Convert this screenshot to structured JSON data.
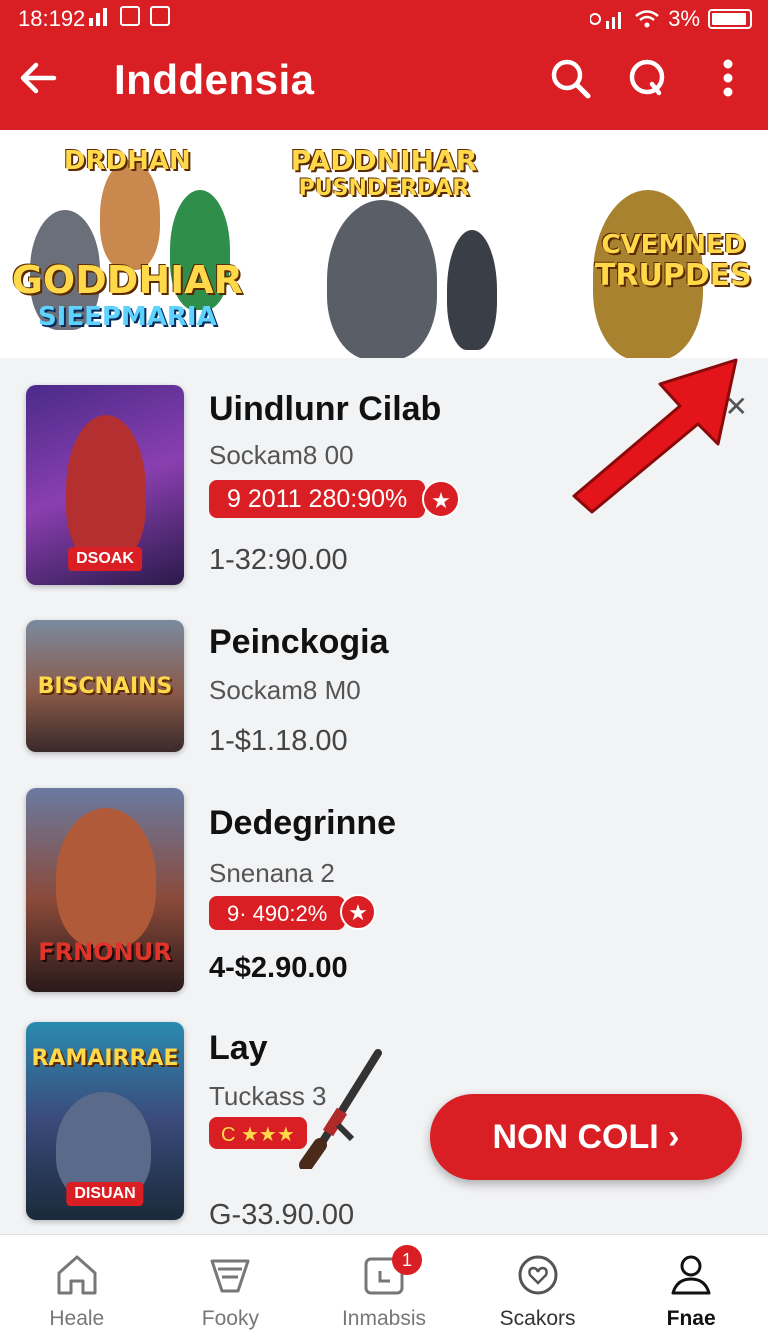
{
  "status": {
    "time": "18:192",
    "battery": "3%"
  },
  "appbar": {
    "title": "Inddensia"
  },
  "banner": [
    {
      "title": "DRDHAN",
      "subtitle": "GODDHIAR",
      "subtitle2": "SIEEPMARIA"
    },
    {
      "title": "PADDNIHAR",
      "subtitle": "PUSNDERDAR"
    },
    {
      "title": "CVEMNED",
      "subtitle": "TRUPDES"
    }
  ],
  "items": [
    {
      "name": "Uindlunr Cilab",
      "sub": "Sockam8 00",
      "badge": "9 2011 280:90%",
      "price": "1-32:90.00",
      "thumb_label": "DSOAK",
      "thumb_title": ""
    },
    {
      "name": "Peinckogia",
      "sub": "Sockam8 M0",
      "badge": "",
      "price": "1-$1.18.00",
      "thumb_label": "",
      "thumb_title": "BISCNAINS"
    },
    {
      "name": "Dedegrinne",
      "sub": "Snenana 2",
      "badge": "9· 490:2%",
      "price": "4-$2.90.00",
      "thumb_label": "",
      "thumb_title": "FRNONUR"
    },
    {
      "name": "Lay",
      "sub": "Tuckass 3",
      "badge": "C ★★★",
      "price": "G-33.90.00",
      "thumb_label": "DISUAN",
      "thumb_title": "RAMAIRRAE"
    }
  ],
  "cta": {
    "label": "NON COLI ›"
  },
  "nav": [
    {
      "label": "Heale",
      "icon": "home-icon"
    },
    {
      "label": "Fooky",
      "icon": "tag-icon"
    },
    {
      "label": "Inmabsis",
      "icon": "inbox-icon",
      "badge": "1"
    },
    {
      "label": "Scakors",
      "icon": "heart-icon"
    },
    {
      "label": "Fnae",
      "icon": "profile-icon"
    }
  ],
  "colors": {
    "primary": "#d91f24",
    "background": "#f2f3f5"
  }
}
